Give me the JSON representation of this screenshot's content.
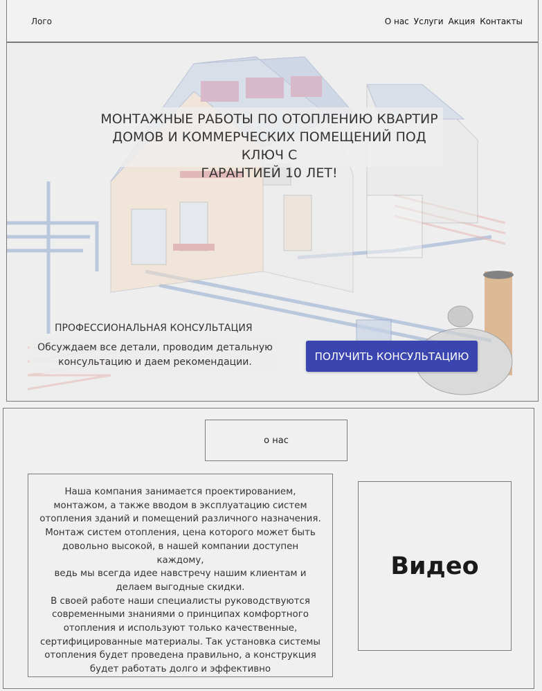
{
  "header": {
    "logo": "Лого",
    "nav": [
      "О нас",
      "Услуги",
      "Акция",
      "Контакты"
    ]
  },
  "hero": {
    "title_lines": [
      "МОНТАЖНЫЕ РАБОТЫ ПО ОТОПЛЕНИЮ КВАРТИР",
      "ДОМОВ И КОММЕРЧЕСКИХ ПОМЕЩЕНИЙ ПОД КЛЮЧ С",
      "ГАРАНТИЕЙ 10 ЛЕТ!"
    ],
    "consult_title": "ПРОФЕССИОНАЛЬНАЯ КОНСУЛЬТАЦИЯ",
    "consult_lines": [
      "Обсуждаем все детали, проводим детальную",
      "консультацию и даем рекомендации."
    ],
    "cta_label": "ПОЛУЧИТЬ КОНСУЛЬТАЦИЮ",
    "cta_color": "#3a45b0"
  },
  "about": {
    "heading": "о нас",
    "text_lines": [
      "Наша компания занимается проектированием,",
      "монтажом, а также вводом в эксплуатацию систем",
      "отопления зданий и помещений различного назначения.",
      "Монтаж систем отопления, цена которого может быть",
      "довольно высокой, в нашей компании доступен каждому,",
      "ведь мы всегда идее навстречу нашим клиентам и",
      "делаем выгодные скидки.",
      "В своей работе наши специалисты руководствуются",
      "современными знаниями о принципах комфортного",
      "отопления и используют только качественные,",
      "сертифицированные материалы. Так установка системы",
      "отопления будет проведена правильно, а конструкция",
      "будет работать долго и эффективно"
    ],
    "video_label": "Видео"
  }
}
